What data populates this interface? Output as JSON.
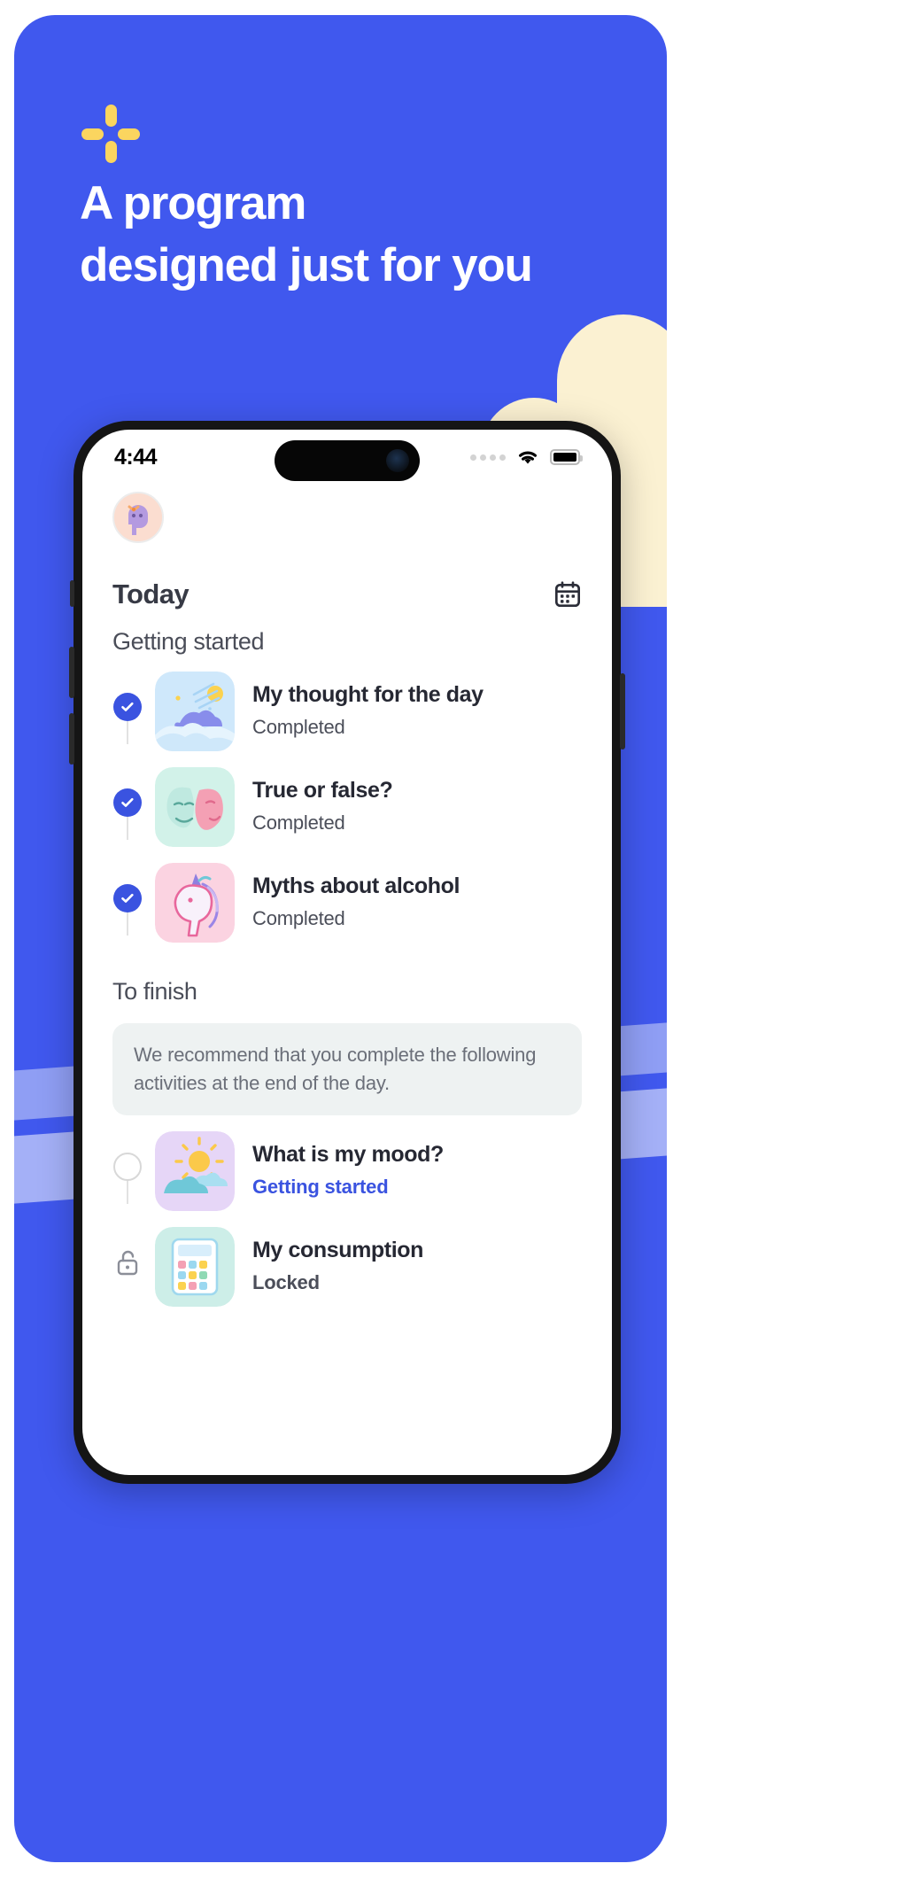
{
  "poster": {
    "background_color": "#4058ee",
    "logo": {
      "icon": "four-bar-plus-icon",
      "color": "#fbd55f"
    },
    "headline_line1": "A program",
    "headline_line2": "designed just for you"
  },
  "phone": {
    "status_bar": {
      "time": "4:44",
      "signal_icon": "signal-dots-icon",
      "wifi_icon": "wifi-icon",
      "battery_icon": "battery-full-icon"
    },
    "app": {
      "avatar": {
        "icon": "hippo-avatar",
        "background": "#fbddd0"
      },
      "header": {
        "title": "Today",
        "calendar_icon": "calendar-icon"
      },
      "sections": [
        {
          "title": "Getting started",
          "tasks": [
            {
              "title": "My thought for the day",
              "status": "Completed",
              "status_type": "completed",
              "bullet": "check-circle-icon",
              "thumb": "clouds-sun-thumb"
            },
            {
              "title": "True or false?",
              "status": "Completed",
              "status_type": "completed",
              "bullet": "check-circle-icon",
              "thumb": "theatre-masks-thumb"
            },
            {
              "title": "Myths about alcohol",
              "status": "Completed",
              "status_type": "completed",
              "bullet": "check-circle-icon",
              "thumb": "unicorn-thumb"
            }
          ]
        },
        {
          "title": "To finish",
          "recommendation": "We recommend that you complete the following activities at the end of the day.",
          "tasks": [
            {
              "title": "What is my mood?",
              "status": "Getting started",
              "status_type": "in-progress",
              "bullet": "empty-circle-icon",
              "thumb": "sun-cloud-thumb"
            },
            {
              "title": "My consumption",
              "status": "Locked",
              "status_type": "locked",
              "bullet": "lock-icon",
              "thumb": "calculator-thumb"
            }
          ]
        }
      ]
    }
  },
  "colors": {
    "brand_blue": "#4058ee",
    "accent_blue": "#3a53e0",
    "logo_yellow": "#fbd55f",
    "cream": "#fbf1d2",
    "band": "#aab6f5",
    "card_grey": "#eef2f2",
    "text_dark": "#262833",
    "text_muted": "#6b6f79"
  }
}
